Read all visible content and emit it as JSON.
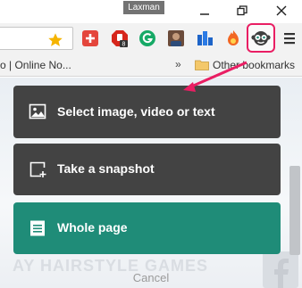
{
  "window": {
    "user_name": "Laxman"
  },
  "toolbar": {
    "extensions": [
      "plus-extension-icon",
      "adblock-extension-icon",
      "grammarly-extension-icon",
      "profile-avatar-icon",
      "extension-icon",
      "firefox-style-icon",
      "monkey-screenshot-extension-icon"
    ],
    "badge_count": "8"
  },
  "bookmarks": {
    "partial_text": "o | Online No...",
    "chevron": "»",
    "other_label": "Other bookmarks"
  },
  "background": {
    "watermark_text": "AY HAIRSTYLE GAMES"
  },
  "popup": {
    "options": [
      {
        "label": "Select image, video or text",
        "icon": "image-icon"
      },
      {
        "label": "Take a snapshot",
        "icon": "snapshot-icon"
      },
      {
        "label": "Whole page",
        "icon": "page-icon"
      }
    ],
    "cancel_label": "Cancel"
  },
  "colors": {
    "dark_option": "#434343",
    "accent_option": "#1f8c78",
    "highlight": "#e91e63"
  }
}
